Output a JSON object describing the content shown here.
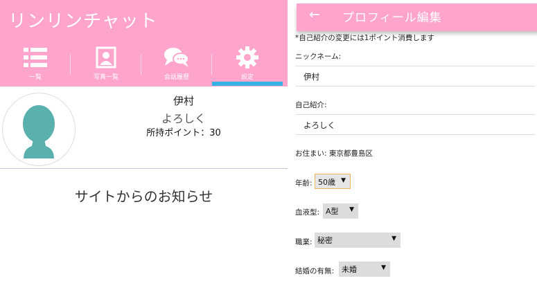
{
  "app": {
    "title": "リンリンチャット",
    "tabs": [
      {
        "label": "一覧",
        "icon": "list-icon"
      },
      {
        "label": "写真一覧",
        "icon": "portrait-icon"
      },
      {
        "label": "会話履歴",
        "icon": "chat-bubbles-icon"
      },
      {
        "label": "設定",
        "icon": "gear-icon"
      }
    ],
    "active_tab": "設定"
  },
  "profile": {
    "name": "伊村",
    "message": "よろしく",
    "points_label": "所持ポイント：30"
  },
  "news": {
    "title": "サイトからのお知らせ"
  },
  "edit": {
    "back_icon": "←",
    "title": "プロフィール編集",
    "note": "*自己紹介の変更には1ポイント消費します",
    "nickname": {
      "label": "ニックネーム:",
      "value": "伊村"
    },
    "intro": {
      "label": "自己紹介:",
      "value": "よろしく"
    },
    "residence": {
      "label": "お住まい:",
      "value": "東京都豊島区"
    },
    "age": {
      "label": "年齢:",
      "value": "50歳"
    },
    "blood": {
      "label": "血液型:",
      "value": "A型"
    },
    "job": {
      "label": "職業:",
      "value": "秘密"
    },
    "marriage": {
      "label": "結婚の有無:",
      "value": "未婚"
    }
  },
  "colors": {
    "header": "#ffa4cc",
    "active_tab": "#34b3e4",
    "avatar": "#5ab0ad"
  }
}
